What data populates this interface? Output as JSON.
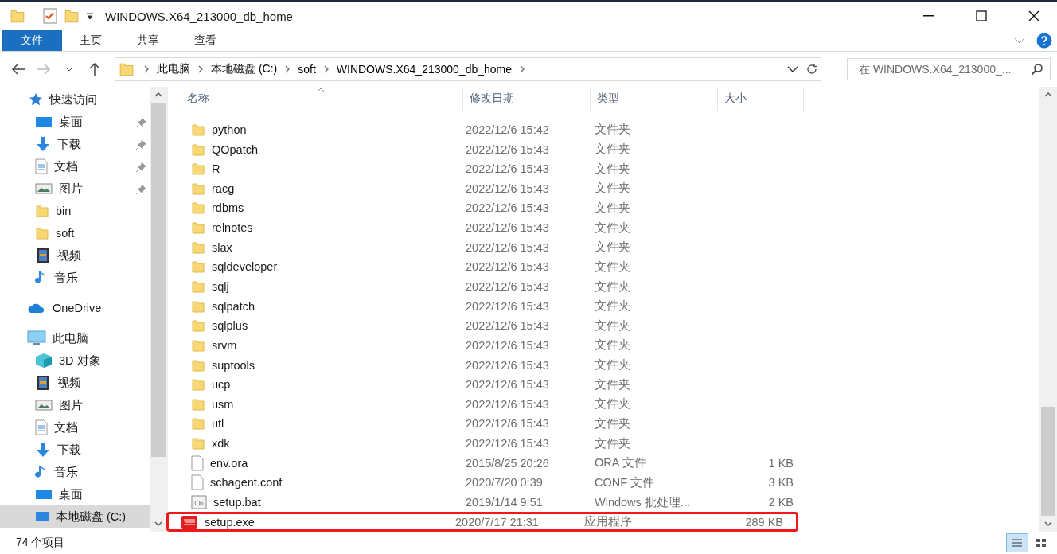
{
  "window": {
    "title": "WINDOWS.X64_213000_db_home"
  },
  "ribbon_tabs": [
    {
      "label": "文件",
      "selected": true
    },
    {
      "label": "主页",
      "selected": false
    },
    {
      "label": "共享",
      "selected": false
    },
    {
      "label": "查看",
      "selected": false
    }
  ],
  "address_bar": {
    "path": [
      "此电脑",
      "本地磁盘 (C:)",
      "soft",
      "WINDOWS.X64_213000_db_home"
    ]
  },
  "search": {
    "placeholder": "在 WINDOWS.X64_213000_..."
  },
  "sidebar": {
    "items": [
      {
        "label": "快速访问",
        "kind": "star",
        "selected": false,
        "children": [
          {
            "label": "桌面",
            "kind": "desktop",
            "pinned": true,
            "selected": false
          },
          {
            "label": "下载",
            "kind": "download",
            "pinned": true,
            "selected": false
          },
          {
            "label": "文档",
            "kind": "document",
            "pinned": true,
            "selected": false
          },
          {
            "label": "图片",
            "kind": "pictures",
            "pinned": true,
            "selected": false
          },
          {
            "label": "bin",
            "kind": "folder",
            "pinned": false,
            "selected": false
          },
          {
            "label": "soft",
            "kind": "folder",
            "pinned": false,
            "selected": false
          },
          {
            "label": "视频",
            "kind": "video",
            "pinned": false,
            "selected": false
          },
          {
            "label": "音乐",
            "kind": "music",
            "pinned": false,
            "selected": false
          }
        ]
      },
      {
        "label": "OneDrive",
        "kind": "cloud",
        "selected": false
      },
      {
        "label": "此电脑",
        "kind": "pc",
        "selected": false,
        "children": [
          {
            "label": "3D 对象",
            "kind": "cube",
            "selected": false
          },
          {
            "label": "视频",
            "kind": "video",
            "selected": false
          },
          {
            "label": "图片",
            "kind": "pictures",
            "selected": false
          },
          {
            "label": "文档",
            "kind": "document",
            "selected": false
          },
          {
            "label": "下载",
            "kind": "download",
            "selected": false
          },
          {
            "label": "音乐",
            "kind": "music",
            "selected": false
          },
          {
            "label": "桌面",
            "kind": "desktop",
            "selected": false
          },
          {
            "label": "本地磁盘 (C:)",
            "kind": "drive",
            "selected": true
          }
        ]
      }
    ]
  },
  "table": {
    "columns": [
      "名称",
      "修改日期",
      "类型",
      "大小"
    ],
    "rows": [
      {
        "kind": "folder",
        "name": "python",
        "date": "2022/12/6 15:42",
        "type": "文件夹",
        "size": "",
        "highlighted": false
      },
      {
        "kind": "folder",
        "name": "QOpatch",
        "date": "2022/12/6 15:43",
        "type": "文件夹",
        "highlighted": false
      },
      {
        "kind": "folder",
        "name": "R",
        "date": "2022/12/6 15:43",
        "type": "文件夹",
        "highlighted": false
      },
      {
        "kind": "folder",
        "name": "racg",
        "date": "2022/12/6 15:43",
        "type": "文件夹",
        "highlighted": false
      },
      {
        "kind": "folder",
        "name": "rdbms",
        "date": "2022/12/6 15:43",
        "type": "文件夹",
        "highlighted": false
      },
      {
        "kind": "folder",
        "name": "relnotes",
        "date": "2022/12/6 15:43",
        "type": "文件夹",
        "highlighted": false
      },
      {
        "kind": "folder",
        "name": "slax",
        "date": "2022/12/6 15:43",
        "type": "文件夹",
        "highlighted": false
      },
      {
        "kind": "folder",
        "name": "sqldeveloper",
        "date": "2022/12/6 15:43",
        "type": "文件夹",
        "highlighted": false
      },
      {
        "kind": "folder",
        "name": "sqlj",
        "date": "2022/12/6 15:43",
        "type": "文件夹",
        "highlighted": false
      },
      {
        "kind": "folder",
        "name": "sqlpatch",
        "date": "2022/12/6 15:43",
        "type": "文件夹",
        "highlighted": false
      },
      {
        "kind": "folder",
        "name": "sqlplus",
        "date": "2022/12/6 15:43",
        "type": "文件夹",
        "highlighted": false
      },
      {
        "kind": "folder",
        "name": "srvm",
        "date": "2022/12/6 15:43",
        "type": "文件夹",
        "highlighted": false
      },
      {
        "kind": "folder",
        "name": "suptools",
        "date": "2022/12/6 15:43",
        "type": "文件夹",
        "highlighted": false
      },
      {
        "kind": "folder",
        "name": "ucp",
        "date": "2022/12/6 15:43",
        "type": "文件夹",
        "highlighted": false
      },
      {
        "kind": "folder",
        "name": "usm",
        "date": "2022/12/6 15:43",
        "type": "文件夹",
        "highlighted": false
      },
      {
        "kind": "folder",
        "name": "utl",
        "date": "2022/12/6 15:43",
        "type": "文件夹",
        "highlighted": false
      },
      {
        "kind": "folder",
        "name": "xdk",
        "date": "2022/12/6 15:43",
        "type": "文件夹",
        "highlighted": false
      },
      {
        "kind": "file",
        "name": "env.ora",
        "date": "2015/8/25 20:26",
        "type": "ORA 文件",
        "size": "1 KB",
        "highlighted": false
      },
      {
        "kind": "file",
        "name": "schagent.conf",
        "date": "2020/7/20 0:39",
        "type": "CONF 文件",
        "size": "3 KB",
        "highlighted": false
      },
      {
        "kind": "batch",
        "name": "setup.bat",
        "date": "2019/1/14 9:51",
        "type": "Windows 批处理...",
        "size": "2 KB",
        "highlighted": false
      },
      {
        "kind": "exe",
        "name": "setup.exe",
        "date": "2020/7/17 21:31",
        "type": "应用程序",
        "size": "289 KB",
        "highlighted": true
      }
    ]
  },
  "status_bar": {
    "item_count": "74 个项目"
  }
}
